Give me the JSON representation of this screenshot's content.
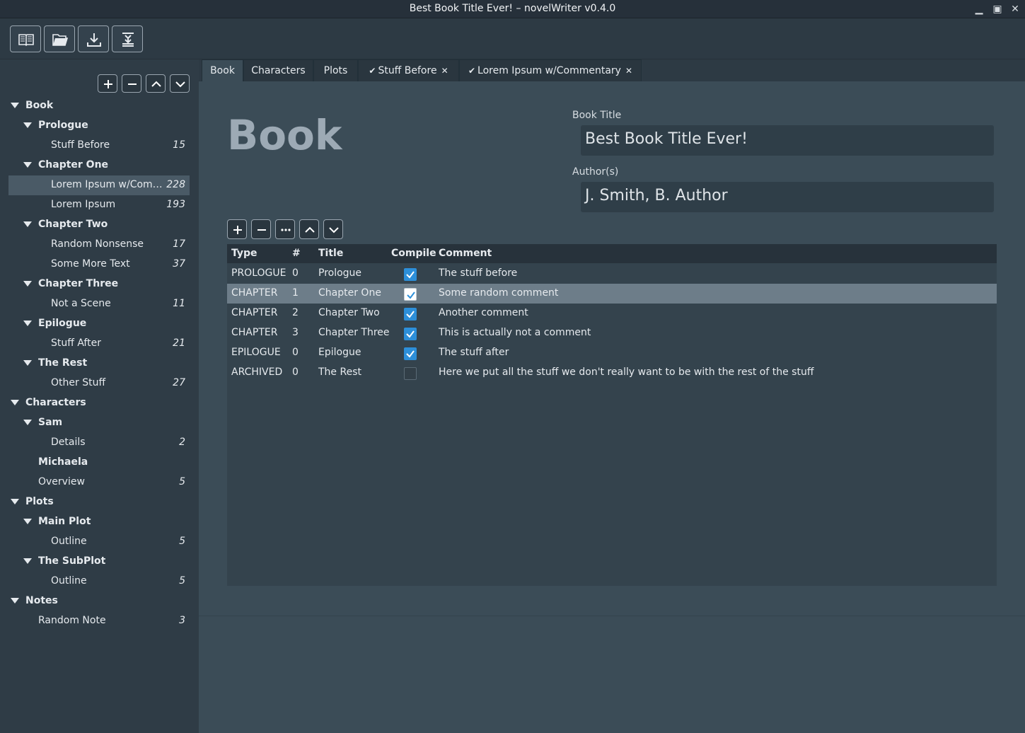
{
  "window": {
    "title": "Best Book Title Ever! – novelWriter v0.4.0",
    "minimize": "▁",
    "maximize": "▣",
    "close": "✕"
  },
  "toolbar": {
    "buttons": [
      "book-icon",
      "open-folder-icon",
      "download-icon",
      "merge-down-icon"
    ]
  },
  "sidebar": {
    "buttons": [
      "plus-icon",
      "minus-icon",
      "chevron-up-icon",
      "chevron-down-icon"
    ],
    "tree": [
      {
        "label": "Book",
        "count": "",
        "level": 0,
        "bold": true,
        "arrow": true
      },
      {
        "label": "Prologue",
        "count": "",
        "level": 1,
        "bold": true,
        "arrow": true
      },
      {
        "label": "Stuff Before",
        "count": "15",
        "level": 2,
        "bold": false,
        "arrow": false
      },
      {
        "label": "Chapter One",
        "count": "",
        "level": 1,
        "bold": true,
        "arrow": true
      },
      {
        "label": "Lorem Ipsum w/Com…",
        "count": "228",
        "level": 2,
        "bold": false,
        "arrow": false,
        "selected": true
      },
      {
        "label": "Lorem Ipsum",
        "count": "193",
        "level": 2,
        "bold": false,
        "arrow": false
      },
      {
        "label": "Chapter Two",
        "count": "",
        "level": 1,
        "bold": true,
        "arrow": true
      },
      {
        "label": "Random Nonsense",
        "count": "17",
        "level": 2,
        "bold": false,
        "arrow": false
      },
      {
        "label": "Some More Text",
        "count": "37",
        "level": 2,
        "bold": false,
        "arrow": false
      },
      {
        "label": "Chapter Three",
        "count": "",
        "level": 1,
        "bold": true,
        "arrow": true
      },
      {
        "label": "Not a Scene",
        "count": "11",
        "level": 2,
        "bold": false,
        "arrow": false
      },
      {
        "label": "Epilogue",
        "count": "",
        "level": 1,
        "bold": true,
        "arrow": true
      },
      {
        "label": "Stuff After",
        "count": "21",
        "level": 2,
        "bold": false,
        "arrow": false
      },
      {
        "label": "The Rest",
        "count": "",
        "level": 1,
        "bold": true,
        "arrow": true
      },
      {
        "label": "Other Stuff",
        "count": "27",
        "level": 2,
        "bold": false,
        "arrow": false
      },
      {
        "label": "Characters",
        "count": "",
        "level": 0,
        "bold": true,
        "arrow": true
      },
      {
        "label": "Sam",
        "count": "",
        "level": 1,
        "bold": true,
        "arrow": true
      },
      {
        "label": "Details",
        "count": "2",
        "level": 2,
        "bold": false,
        "arrow": false
      },
      {
        "label": "Michaela",
        "count": "",
        "level": 1,
        "bold": true,
        "arrow": false
      },
      {
        "label": "Overview",
        "count": "5",
        "level": 1,
        "bold": false,
        "arrow": false
      },
      {
        "label": "Plots",
        "count": "",
        "level": 0,
        "bold": true,
        "arrow": true
      },
      {
        "label": "Main Plot",
        "count": "",
        "level": 1,
        "bold": true,
        "arrow": true
      },
      {
        "label": "Outline",
        "count": "5",
        "level": 2,
        "bold": false,
        "arrow": false
      },
      {
        "label": "The SubPlot",
        "count": "",
        "level": 1,
        "bold": true,
        "arrow": true
      },
      {
        "label": "Outline",
        "count": "5",
        "level": 2,
        "bold": false,
        "arrow": false
      },
      {
        "label": "Notes",
        "count": "",
        "level": 0,
        "bold": true,
        "arrow": true
      },
      {
        "label": "Random Note",
        "count": "3",
        "level": 1,
        "bold": false,
        "arrow": false
      }
    ]
  },
  "tabs": [
    {
      "label": "Book",
      "active": true,
      "check": false,
      "closable": false
    },
    {
      "label": "Characters",
      "active": false,
      "check": false,
      "closable": false
    },
    {
      "label": "Plots",
      "active": false,
      "check": false,
      "closable": false
    },
    {
      "label": "Stuff Before",
      "active": false,
      "check": true,
      "closable": true
    },
    {
      "label": "Lorem Ipsum w/Commentary",
      "active": false,
      "check": true,
      "closable": true
    }
  ],
  "tab_glyphs": {
    "check": "✔",
    "close": "✕"
  },
  "book_panel": {
    "heading": "Book",
    "book_title_label": "Book Title",
    "book_title_value": "Best Book Title Ever!",
    "authors_label": "Author(s)",
    "authors_value": "J. Smith, B. Author",
    "edit_buttons": [
      "plus-icon",
      "minus-icon",
      "more-icon",
      "chevron-up-icon",
      "chevron-down-icon"
    ]
  },
  "table": {
    "headers": [
      "Type",
      "#",
      "Title",
      "Compile",
      "Comment"
    ],
    "rows": [
      {
        "type": "PROLOGUE",
        "num": "0",
        "title": "Prologue",
        "compile": true,
        "comment": "The stuff before",
        "selected": false
      },
      {
        "type": "CHAPTER",
        "num": "1",
        "title": "Chapter One",
        "compile": true,
        "comment": "Some random comment",
        "selected": true
      },
      {
        "type": "CHAPTER",
        "num": "2",
        "title": "Chapter Two",
        "compile": true,
        "comment": "Another comment",
        "selected": false
      },
      {
        "type": "CHAPTER",
        "num": "3",
        "title": "Chapter Three",
        "compile": true,
        "comment": "This is actually not a comment",
        "selected": false
      },
      {
        "type": "EPILOGUE",
        "num": "0",
        "title": "Epilogue",
        "compile": true,
        "comment": "The stuff after",
        "selected": false
      },
      {
        "type": "ARCHIVED",
        "num": "0",
        "title": "The Rest",
        "compile": false,
        "comment": "Here we put all the stuff we don't really want to be with the rest of the stuff",
        "selected": false
      }
    ]
  },
  "colors": {
    "accent_checkbox": "#2d8fd9",
    "selection": "#6d7d89",
    "sidebar_selection": "#4a5a66"
  }
}
